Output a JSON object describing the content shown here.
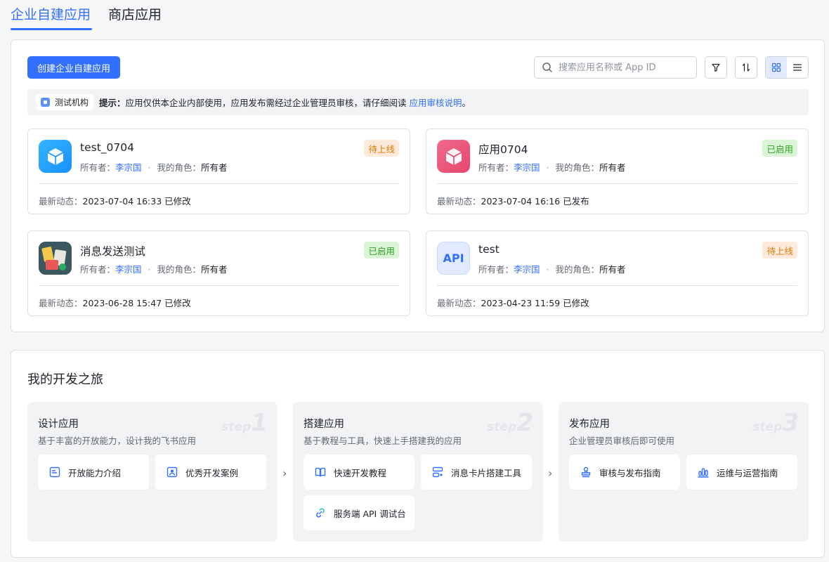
{
  "tabs": {
    "active": "企业自建应用",
    "other": "商店应用"
  },
  "toolbar": {
    "create_label": "创建企业自建应用",
    "search_placeholder": "搜索应用名称或 App ID"
  },
  "notice": {
    "org_name": "测试机构",
    "prefix": "提示：",
    "text": "应用仅供本企业内部使用，应用发布需经过企业管理员审核，请仔细阅读",
    "link": "应用审核说明",
    "suffix": "。"
  },
  "apps": [
    {
      "name": "test_0704",
      "status": "待上线",
      "owner_label": "所有者：",
      "owner": "李宗国",
      "role_label": "我的角色：",
      "role": "所有者",
      "latest_label": "最新动态：",
      "latest": "2023-07-04 16:33  已修改"
    },
    {
      "name": "应用0704",
      "status": "已启用",
      "owner_label": "所有者：",
      "owner": "李宗国",
      "role_label": "我的角色：",
      "role": "所有者",
      "latest_label": "最新动态：",
      "latest": "2023-07-04 16:16  已发布"
    },
    {
      "name": "消息发送测试",
      "status": "已启用",
      "owner_label": "所有者：",
      "owner": "李宗国",
      "role_label": "我的角色：",
      "role": "所有者",
      "latest_label": "最新动态：",
      "latest": "2023-06-28 15:47  已修改"
    },
    {
      "name": "test",
      "status": "待上线",
      "owner_label": "所有者：",
      "owner": "李宗国",
      "role_label": "我的角色：",
      "role": "所有者",
      "latest_label": "最新动态：",
      "latest": "2023-04-23 11:59  已修改",
      "icon_text": "API"
    }
  ],
  "journey": {
    "title": "我的开发之旅",
    "steps": [
      {
        "title": "设计应用",
        "desc": "基于丰富的开放能力，设计我的飞书应用",
        "mark_word": "step",
        "mark_num": "1",
        "tools": [
          "开放能力介绍",
          "优秀开发案例"
        ]
      },
      {
        "title": "搭建应用",
        "desc": "基于教程与工具，快速上手搭建我的应用",
        "mark_word": "step",
        "mark_num": "2",
        "tools": [
          "快速开发教程",
          "消息卡片搭建工具",
          "服务端 API 调试台"
        ]
      },
      {
        "title": "发布应用",
        "desc": "企业管理员审核后即可使用",
        "mark_word": "step",
        "mark_num": "3",
        "tools": [
          "审核与发布指南",
          "运维与运营指南"
        ]
      }
    ],
    "separator": "›"
  },
  "colors": {
    "accent": "#3370ff",
    "pending_bg": "#feeadb",
    "pending_fg": "#de7802",
    "enabled_bg": "#d9f5d6",
    "enabled_fg": "#2ea121"
  }
}
